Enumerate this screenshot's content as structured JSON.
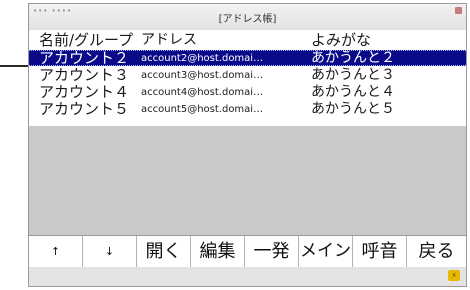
{
  "window": {
    "title": "[アドレス帳]",
    "left_dots": "••• ••••"
  },
  "list": {
    "header": {
      "name": "名前/グループ",
      "address": "アドレス",
      "reading": "よみがな"
    },
    "rows": [
      {
        "name": "アカウント２",
        "address": "account2@host.domai…",
        "reading": "あかうんと２",
        "selected": true
      },
      {
        "name": "アカウント３",
        "address": "account3@host.domai…",
        "reading": "あかうんと３",
        "selected": false
      },
      {
        "name": "アカウント４",
        "address": "account4@host.domai…",
        "reading": "あかうんと４",
        "selected": false
      },
      {
        "name": "アカウント５",
        "address": "account5@host.domai…",
        "reading": "あかうんと５",
        "selected": false
      }
    ]
  },
  "function_keys": [
    {
      "label": "↑",
      "icon": "arrow-up-icon"
    },
    {
      "label": "↓",
      "icon": "arrow-down-icon"
    },
    {
      "label": "開く"
    },
    {
      "label": "編集"
    },
    {
      "label": "一発"
    },
    {
      "label": "メイン"
    },
    {
      "label": "呼音"
    },
    {
      "label": "戻る"
    }
  ],
  "status": {
    "icon": "battery-icon",
    "icon_glyph": "⚡",
    "icon_color": "#e8b800"
  },
  "colors": {
    "selection": "#0b0b8a",
    "list_bg": "#c9c9c9"
  }
}
